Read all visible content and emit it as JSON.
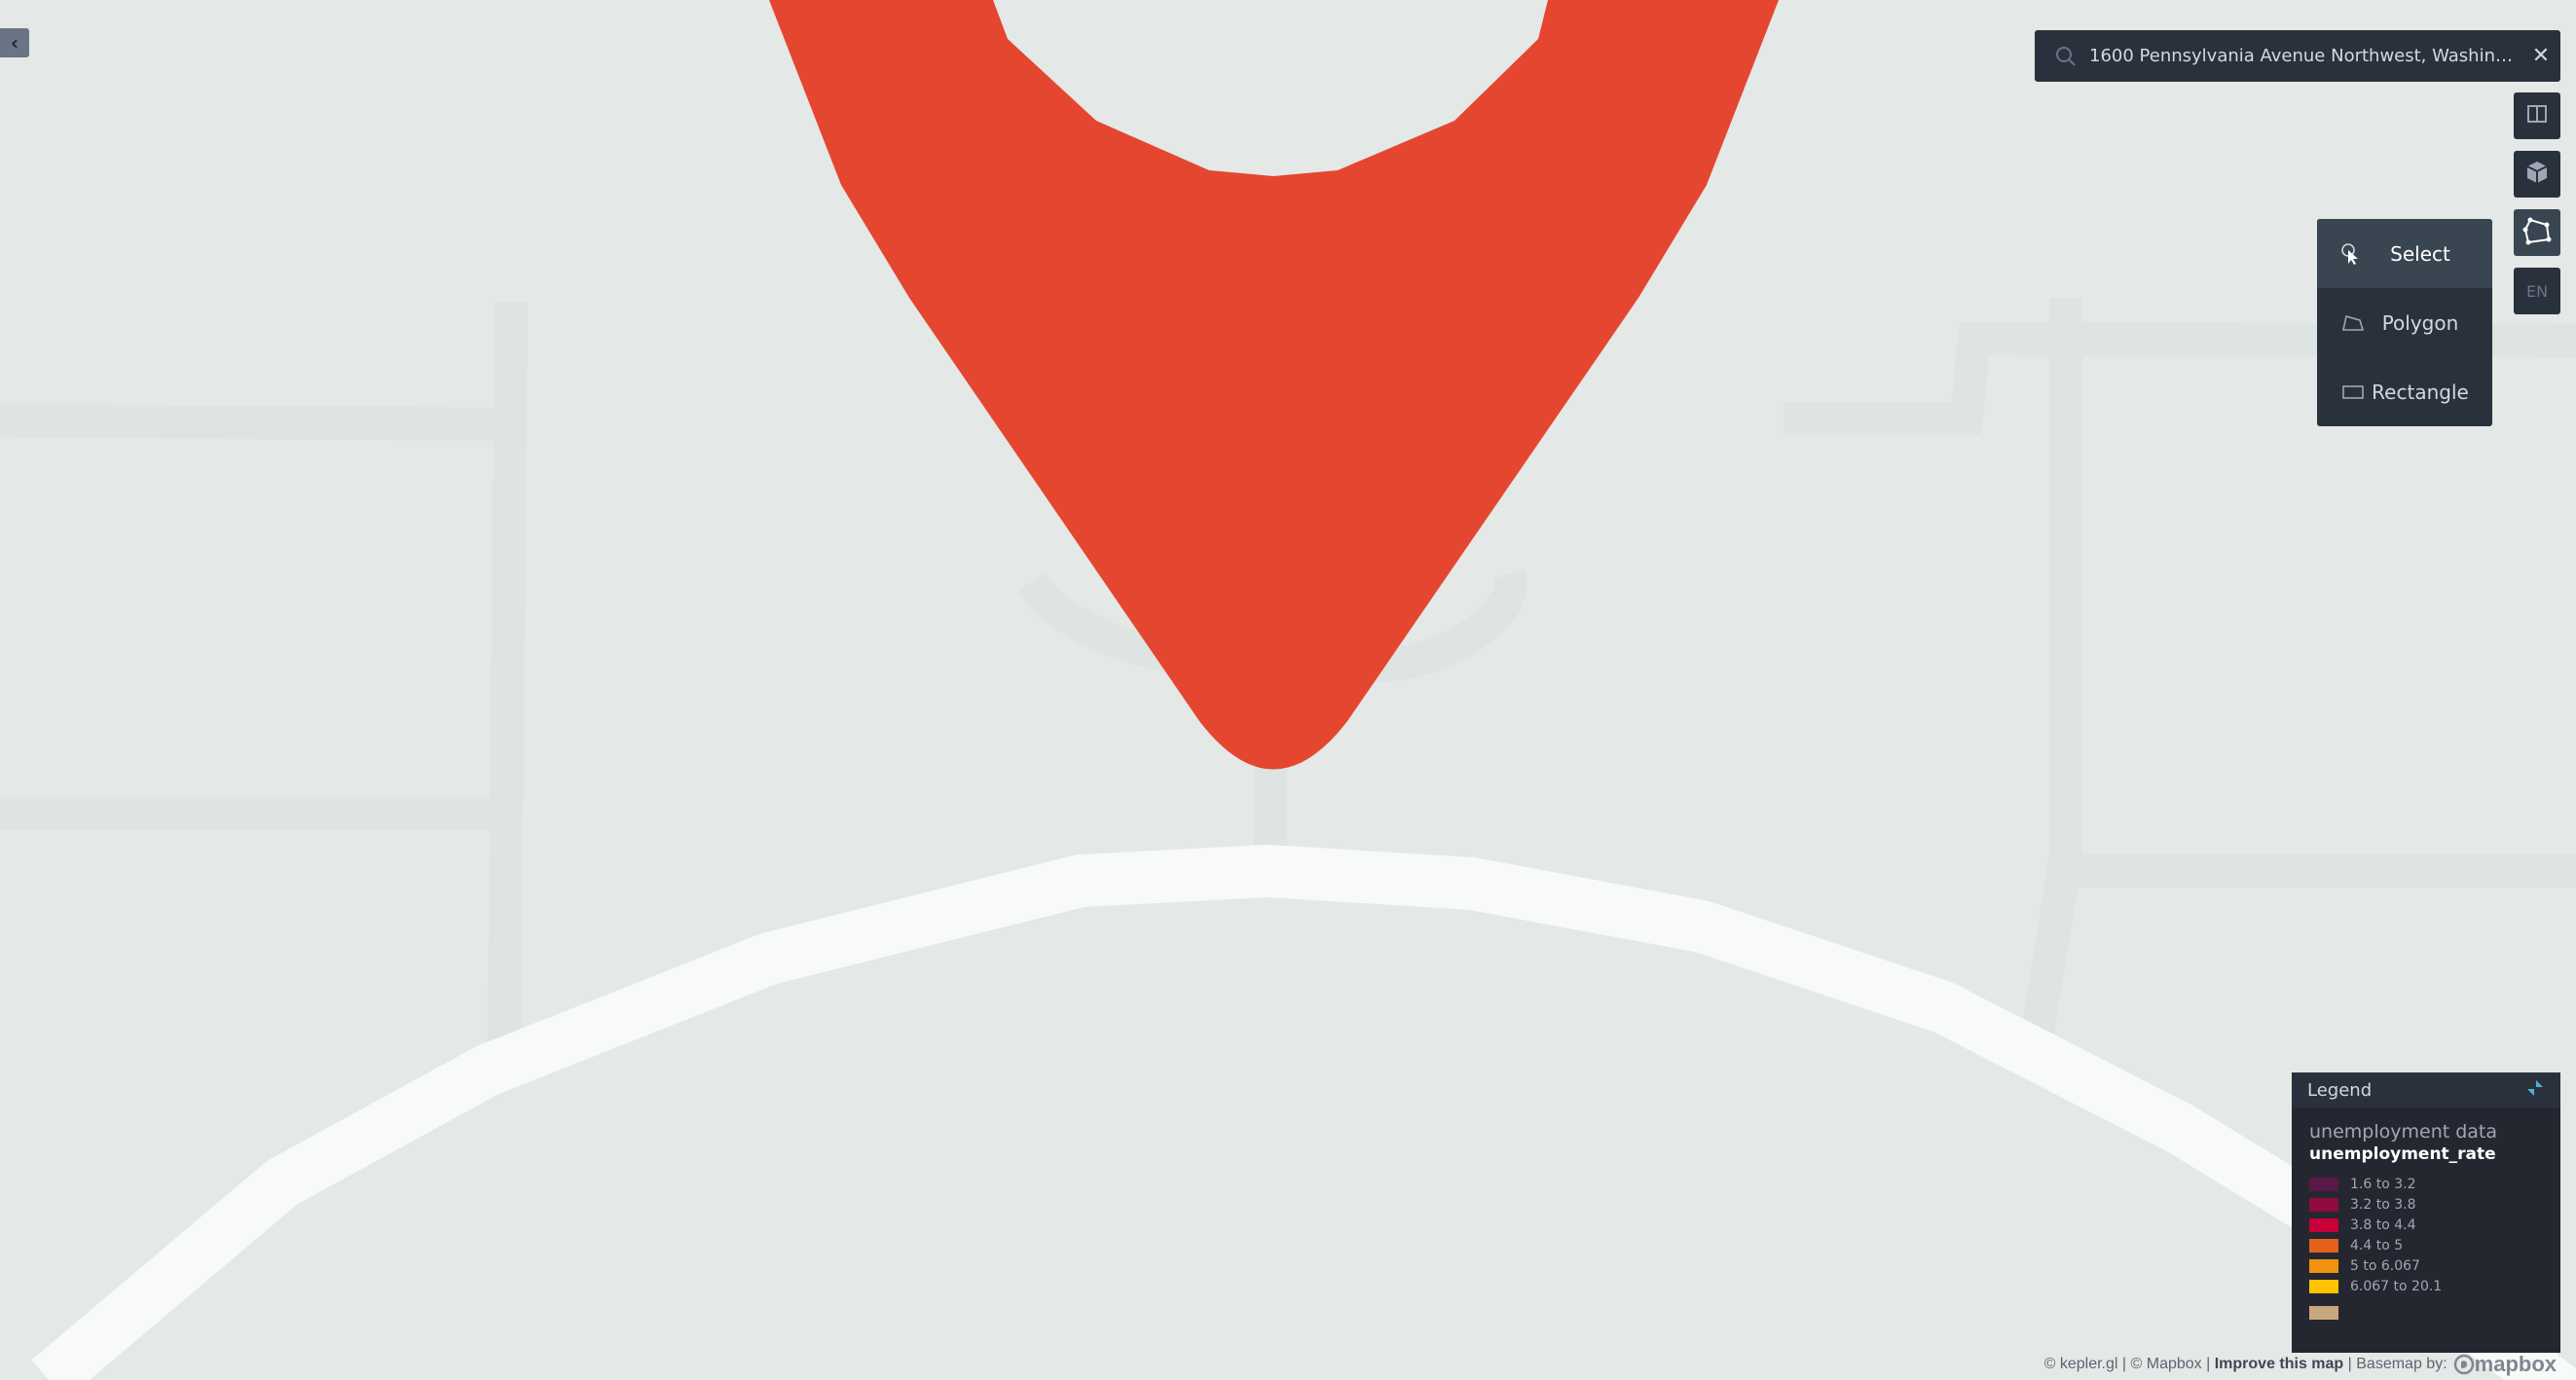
{
  "search": {
    "query": "1600 Pennsylvania Avenue Northwest, Washington...",
    "clear_icon": "close-icon"
  },
  "controls": {
    "split_icon": "split-map-icon",
    "layers_icon": "layers-icon",
    "draw_icon": "draw-polygon-icon",
    "locale_label": "EN"
  },
  "draw_menu": {
    "items": [
      {
        "label": "Select",
        "icon": "pointer-icon"
      },
      {
        "label": "Polygon",
        "icon": "polygon-icon"
      },
      {
        "label": "Rectangle",
        "icon": "rectangle-icon"
      }
    ]
  },
  "legend": {
    "title": "Legend",
    "layer_name": "unemployment data",
    "field_name": "unemployment_rate",
    "items": [
      {
        "label": "1.6 to 3.2",
        "color": "#5a1846"
      },
      {
        "label": "3.2 to 3.8",
        "color": "#900c3f"
      },
      {
        "label": "3.8 to 4.4",
        "color": "#c70039"
      },
      {
        "label": "4.4 to 5",
        "color": "#e3611c"
      },
      {
        "label": "5 to 6.067",
        "color": "#f1920e"
      },
      {
        "label": "6.067 to 20.1",
        "color": "#ffc300"
      }
    ],
    "null_color": "#c9a77c"
  },
  "attribution": {
    "part1": "© kepler.gl | © Mapbox |",
    "improve": "Improve this map",
    "part2": "| Basemap by:",
    "logo_text": "mapbox"
  },
  "map": {
    "marker_color": "#e54630",
    "background_color": "#e4e8e6",
    "street_color": "#dde4e1",
    "major_road_color": "#f8faf9"
  }
}
